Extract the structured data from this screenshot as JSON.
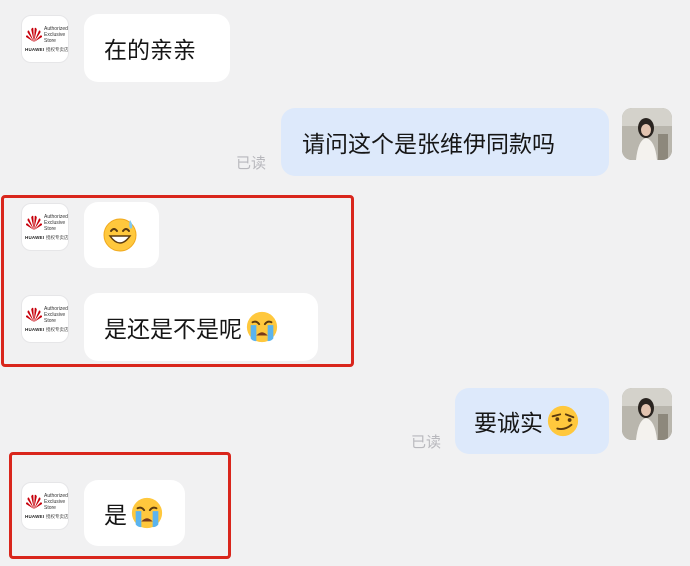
{
  "store": {
    "brand": "HUAWEI",
    "authorized_lines": [
      "Authorized",
      "Exclusive",
      "Store"
    ],
    "cn_caption": "授权专卖店"
  },
  "messages": [
    {
      "side": "left",
      "text": "在的亲亲"
    },
    {
      "side": "right",
      "text": "请问这个是张维伊同款吗",
      "status": "已读"
    },
    {
      "side": "left",
      "text": "",
      "emoji": "smiling-sweat-emoji"
    },
    {
      "side": "left",
      "text": "是还是不是呢",
      "emoji": "loudly-crying-emoji"
    },
    {
      "side": "right",
      "text": "要诚实",
      "emoji": "smirking-face-emoji",
      "status": "已读"
    },
    {
      "side": "left",
      "text": "是",
      "emoji": "loudly-crying-emoji"
    }
  ],
  "colors": {
    "background": "#f1f1f2",
    "incoming_bubble": "#ffffff",
    "outgoing_bubble": "#dde9fb",
    "highlight_box": "#d9261c",
    "read_status": "#b8b8bd"
  }
}
